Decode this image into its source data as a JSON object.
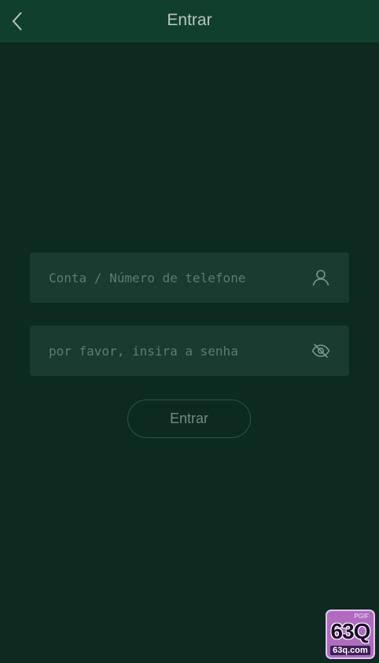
{
  "header": {
    "title": "Entrar",
    "back_icon": "chevron-left-icon"
  },
  "form": {
    "account": {
      "value": "",
      "placeholder": "Conta / Número de telefone",
      "icon": "user-icon"
    },
    "password": {
      "value": "",
      "placeholder": "por favor, insira a senha",
      "icon": "eye-off-icon"
    },
    "submit_label": "Entrar"
  },
  "badge": {
    "top_text": "PGIF",
    "main_text": "63Q",
    "url_text": "63q.com"
  },
  "colors": {
    "background": "#0c2a1f",
    "header": "#113f2d",
    "field": "#1a3b2f",
    "badge": "#b06bbe"
  }
}
